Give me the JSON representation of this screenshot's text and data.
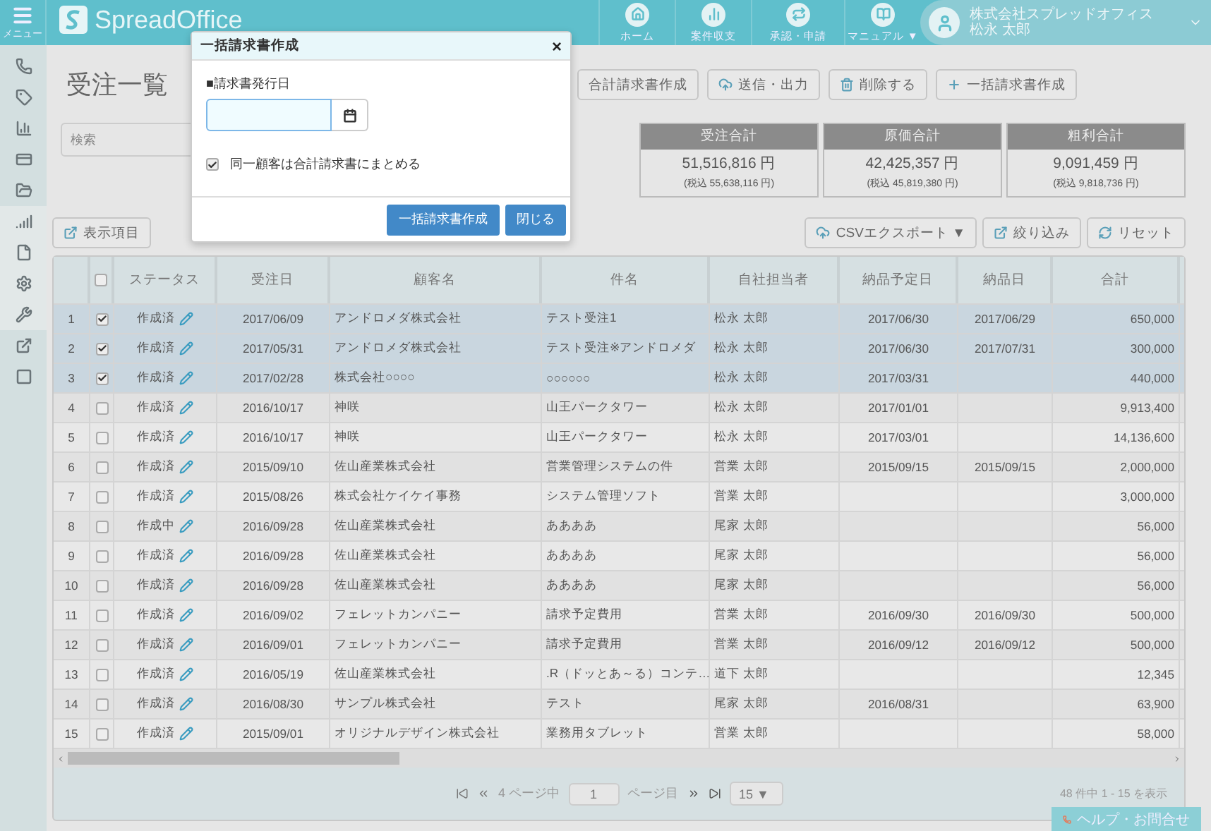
{
  "header": {
    "menu_label": "メニュー",
    "logo": "SpreadOffice",
    "nav": [
      {
        "label": "ホーム"
      },
      {
        "label": "案件収支"
      },
      {
        "label": "承認・申請"
      },
      {
        "label": "マニュアル ▼"
      }
    ],
    "user": {
      "company": "株式会社スプレッドオフィス",
      "name": "松永 太郎"
    }
  },
  "sidebar": {
    "items": [
      {
        "highlighted": false
      },
      {
        "highlighted": false
      },
      {
        "highlighted": false
      },
      {
        "highlighted": false
      },
      {
        "highlighted": false
      },
      {
        "highlighted": true
      },
      {
        "highlighted": true
      },
      {
        "highlighted": true
      },
      {
        "highlighted": true
      },
      {
        "highlighted": false
      },
      {
        "highlighted": false
      }
    ]
  },
  "page_title": "受注一覧",
  "toolbar": [
    "合計請求書作成",
    "送信・出力",
    "削除する",
    "一括請求書作成"
  ],
  "search": {
    "placeholder": "検索"
  },
  "summary": [
    {
      "title": "受注合計",
      "amount": "51,516,816 円",
      "tax": "(税込 55,638,116 円)"
    },
    {
      "title": "原価合計",
      "amount": "42,425,357 円",
      "tax": "(税込 45,819,380 円)"
    },
    {
      "title": "粗利合計",
      "amount": "9,091,459 円",
      "tax": "(税込 9,818,736 円)"
    }
  ],
  "columns_button": "表示項目",
  "list_actions": [
    "CSVエクスポート ▼",
    "絞り込み",
    "リセット"
  ],
  "table": {
    "header_checked": false,
    "columns": [
      "ステータス",
      "受注日",
      "顧客名",
      "件名",
      "自社担当者",
      "納品予定日",
      "納品日",
      "合計"
    ],
    "rows": [
      {
        "no": "1",
        "checked": true,
        "selected": true,
        "cells": [
          "作成済",
          "2017/06/09",
          "アンドロメダ株式会社",
          "テスト受注1",
          "松永 太郎",
          "2017/06/30",
          "2017/06/29",
          "650,000"
        ]
      },
      {
        "no": "2",
        "checked": true,
        "selected": true,
        "cells": [
          "作成済",
          "2017/05/31",
          "アンドロメダ株式会社",
          "テスト受注※アンドロメダ",
          "松永 太郎",
          "2017/06/30",
          "2017/07/31",
          "300,000"
        ]
      },
      {
        "no": "3",
        "checked": true,
        "selected": true,
        "cells": [
          "作成済",
          "2017/02/28",
          "株式会社○○○○",
          "○○○○○○",
          "松永 太郎",
          "2017/03/31",
          "",
          "440,000"
        ]
      },
      {
        "no": "4",
        "checked": false,
        "selected": false,
        "cells": [
          "作成済",
          "2016/10/17",
          "神咲",
          "山王パークタワー",
          "松永 太郎",
          "2017/01/01",
          "",
          "9,913,400"
        ]
      },
      {
        "no": "5",
        "checked": false,
        "selected": false,
        "cells": [
          "作成済",
          "2016/10/17",
          "神咲",
          "山王パークタワー",
          "松永 太郎",
          "2017/03/01",
          "",
          "14,136,600"
        ]
      },
      {
        "no": "6",
        "checked": false,
        "selected": false,
        "cells": [
          "作成済",
          "2015/09/10",
          "佐山産業株式会社",
          "営業管理システムの件",
          "営業 太郎",
          "2015/09/15",
          "2015/09/15",
          "2,000,000"
        ]
      },
      {
        "no": "7",
        "checked": false,
        "selected": false,
        "cells": [
          "作成済",
          "2015/08/26",
          "株式会社ケイケイ事務",
          "システム管理ソフト",
          "営業 太郎",
          "",
          "",
          "3,000,000"
        ]
      },
      {
        "no": "8",
        "checked": false,
        "selected": false,
        "cells": [
          "作成中",
          "2016/09/28",
          "佐山産業株式会社",
          "ああああ",
          "尾家 太郎",
          "",
          "",
          "56,000"
        ]
      },
      {
        "no": "9",
        "checked": false,
        "selected": false,
        "cells": [
          "作成済",
          "2016/09/28",
          "佐山産業株式会社",
          "ああああ",
          "尾家 太郎",
          "",
          "",
          "56,000"
        ]
      },
      {
        "no": "10",
        "checked": false,
        "selected": false,
        "cells": [
          "作成済",
          "2016/09/28",
          "佐山産業株式会社",
          "ああああ",
          "尾家 太郎",
          "",
          "",
          "56,000"
        ]
      },
      {
        "no": "11",
        "checked": false,
        "selected": false,
        "cells": [
          "作成済",
          "2016/09/02",
          "フェレットカンパニー",
          "請求予定費用",
          "営業 太郎",
          "2016/09/30",
          "2016/09/30",
          "500,000"
        ]
      },
      {
        "no": "12",
        "checked": false,
        "selected": false,
        "cells": [
          "作成済",
          "2016/09/01",
          "フェレットカンパニー",
          "請求予定費用",
          "営業 太郎",
          "2016/09/12",
          "2016/09/12",
          "500,000"
        ]
      },
      {
        "no": "13",
        "checked": false,
        "selected": false,
        "cells": [
          "作成済",
          "2016/05/19",
          "佐山産業株式会社",
          ".R（ドッとあ～る）コンテ…",
          "道下 太郎",
          "",
          "",
          "12,345"
        ]
      },
      {
        "no": "14",
        "checked": false,
        "selected": false,
        "cells": [
          "作成済",
          "2016/08/30",
          "サンプル株式会社",
          "テスト",
          "尾家 太郎",
          "2016/08/31",
          "",
          "63,900"
        ]
      },
      {
        "no": "15",
        "checked": false,
        "selected": false,
        "cells": [
          "作成済",
          "2015/09/01",
          "オリジナルデザイン株式会社",
          "業務用タブレット",
          "営業 太郎",
          "",
          "",
          "58,000"
        ]
      }
    ]
  },
  "pager": {
    "of_pages": "4 ページ中",
    "page": "1",
    "page_suffix": "ページ目",
    "per_page": "15 ▼",
    "summary": "48 件中 1 - 15 を表示"
  },
  "help_button": "ヘルプ・お問合せ",
  "dialog": {
    "title": "一括請求書作成",
    "close": "×",
    "date_label": "■請求書発行日",
    "merge_label": "同一顧客は合計請求書にまとめる",
    "merge_checked": true,
    "buttons": [
      "一括請求書作成",
      "閉じる"
    ]
  }
}
